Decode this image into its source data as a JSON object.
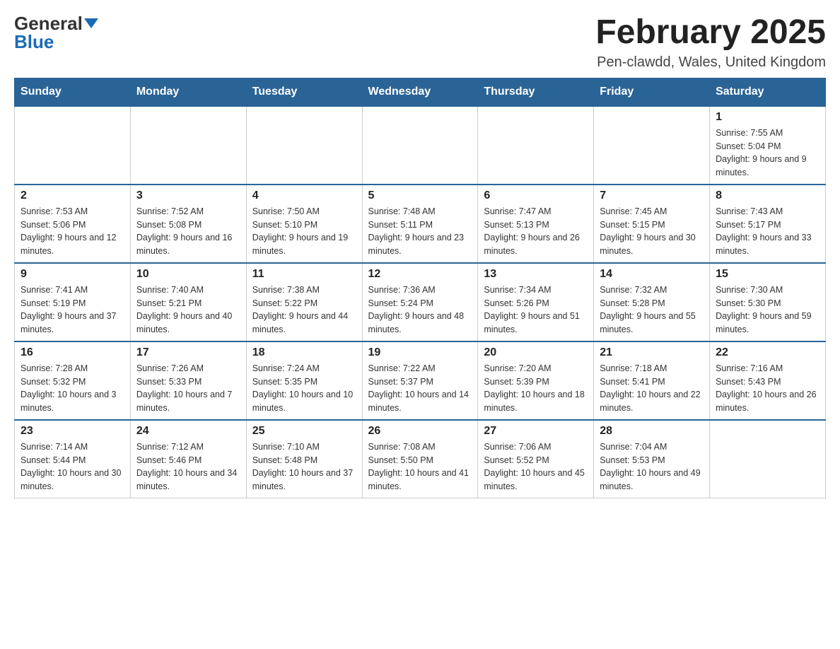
{
  "header": {
    "logo_general": "General",
    "logo_blue": "Blue",
    "month_title": "February 2025",
    "location": "Pen-clawdd, Wales, United Kingdom"
  },
  "days_of_week": [
    "Sunday",
    "Monday",
    "Tuesday",
    "Wednesday",
    "Thursday",
    "Friday",
    "Saturday"
  ],
  "weeks": [
    [
      {
        "day": "",
        "info": ""
      },
      {
        "day": "",
        "info": ""
      },
      {
        "day": "",
        "info": ""
      },
      {
        "day": "",
        "info": ""
      },
      {
        "day": "",
        "info": ""
      },
      {
        "day": "",
        "info": ""
      },
      {
        "day": "1",
        "info": "Sunrise: 7:55 AM\nSunset: 5:04 PM\nDaylight: 9 hours and 9 minutes."
      }
    ],
    [
      {
        "day": "2",
        "info": "Sunrise: 7:53 AM\nSunset: 5:06 PM\nDaylight: 9 hours and 12 minutes."
      },
      {
        "day": "3",
        "info": "Sunrise: 7:52 AM\nSunset: 5:08 PM\nDaylight: 9 hours and 16 minutes."
      },
      {
        "day": "4",
        "info": "Sunrise: 7:50 AM\nSunset: 5:10 PM\nDaylight: 9 hours and 19 minutes."
      },
      {
        "day": "5",
        "info": "Sunrise: 7:48 AM\nSunset: 5:11 PM\nDaylight: 9 hours and 23 minutes."
      },
      {
        "day": "6",
        "info": "Sunrise: 7:47 AM\nSunset: 5:13 PM\nDaylight: 9 hours and 26 minutes."
      },
      {
        "day": "7",
        "info": "Sunrise: 7:45 AM\nSunset: 5:15 PM\nDaylight: 9 hours and 30 minutes."
      },
      {
        "day": "8",
        "info": "Sunrise: 7:43 AM\nSunset: 5:17 PM\nDaylight: 9 hours and 33 minutes."
      }
    ],
    [
      {
        "day": "9",
        "info": "Sunrise: 7:41 AM\nSunset: 5:19 PM\nDaylight: 9 hours and 37 minutes."
      },
      {
        "day": "10",
        "info": "Sunrise: 7:40 AM\nSunset: 5:21 PM\nDaylight: 9 hours and 40 minutes."
      },
      {
        "day": "11",
        "info": "Sunrise: 7:38 AM\nSunset: 5:22 PM\nDaylight: 9 hours and 44 minutes."
      },
      {
        "day": "12",
        "info": "Sunrise: 7:36 AM\nSunset: 5:24 PM\nDaylight: 9 hours and 48 minutes."
      },
      {
        "day": "13",
        "info": "Sunrise: 7:34 AM\nSunset: 5:26 PM\nDaylight: 9 hours and 51 minutes."
      },
      {
        "day": "14",
        "info": "Sunrise: 7:32 AM\nSunset: 5:28 PM\nDaylight: 9 hours and 55 minutes."
      },
      {
        "day": "15",
        "info": "Sunrise: 7:30 AM\nSunset: 5:30 PM\nDaylight: 9 hours and 59 minutes."
      }
    ],
    [
      {
        "day": "16",
        "info": "Sunrise: 7:28 AM\nSunset: 5:32 PM\nDaylight: 10 hours and 3 minutes."
      },
      {
        "day": "17",
        "info": "Sunrise: 7:26 AM\nSunset: 5:33 PM\nDaylight: 10 hours and 7 minutes."
      },
      {
        "day": "18",
        "info": "Sunrise: 7:24 AM\nSunset: 5:35 PM\nDaylight: 10 hours and 10 minutes."
      },
      {
        "day": "19",
        "info": "Sunrise: 7:22 AM\nSunset: 5:37 PM\nDaylight: 10 hours and 14 minutes."
      },
      {
        "day": "20",
        "info": "Sunrise: 7:20 AM\nSunset: 5:39 PM\nDaylight: 10 hours and 18 minutes."
      },
      {
        "day": "21",
        "info": "Sunrise: 7:18 AM\nSunset: 5:41 PM\nDaylight: 10 hours and 22 minutes."
      },
      {
        "day": "22",
        "info": "Sunrise: 7:16 AM\nSunset: 5:43 PM\nDaylight: 10 hours and 26 minutes."
      }
    ],
    [
      {
        "day": "23",
        "info": "Sunrise: 7:14 AM\nSunset: 5:44 PM\nDaylight: 10 hours and 30 minutes."
      },
      {
        "day": "24",
        "info": "Sunrise: 7:12 AM\nSunset: 5:46 PM\nDaylight: 10 hours and 34 minutes."
      },
      {
        "day": "25",
        "info": "Sunrise: 7:10 AM\nSunset: 5:48 PM\nDaylight: 10 hours and 37 minutes."
      },
      {
        "day": "26",
        "info": "Sunrise: 7:08 AM\nSunset: 5:50 PM\nDaylight: 10 hours and 41 minutes."
      },
      {
        "day": "27",
        "info": "Sunrise: 7:06 AM\nSunset: 5:52 PM\nDaylight: 10 hours and 45 minutes."
      },
      {
        "day": "28",
        "info": "Sunrise: 7:04 AM\nSunset: 5:53 PM\nDaylight: 10 hours and 49 minutes."
      },
      {
        "day": "",
        "info": ""
      }
    ]
  ]
}
